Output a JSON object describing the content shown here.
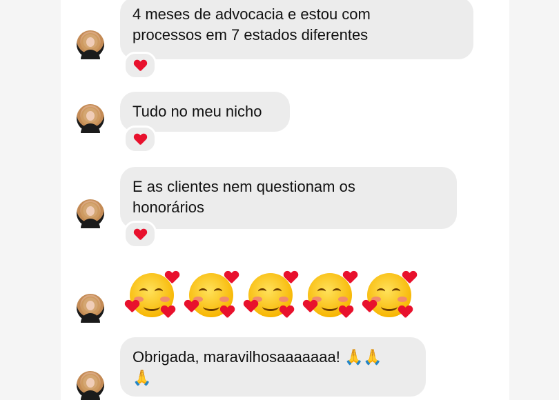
{
  "messages": [
    {
      "text": "4 meses de advocacia e estou com\nprocessos em 7 estados diferentes",
      "reaction": "heart-icon"
    },
    {
      "text": "Tudo no meu nicho",
      "reaction": "heart-icon"
    },
    {
      "text": "E as clientes nem questionam os\nhonorários",
      "reaction": "heart-icon"
    },
    {
      "text": "Obrigada, maravilhosaaaaaaa! 🙏🙏\n🙏"
    }
  ],
  "emoji_row": [
    "🥰",
    "🥰",
    "🥰",
    "🥰",
    "🥰"
  ],
  "colors": {
    "bubble": "#ececec",
    "background": "#ffffff",
    "heart": "#e8112d"
  }
}
